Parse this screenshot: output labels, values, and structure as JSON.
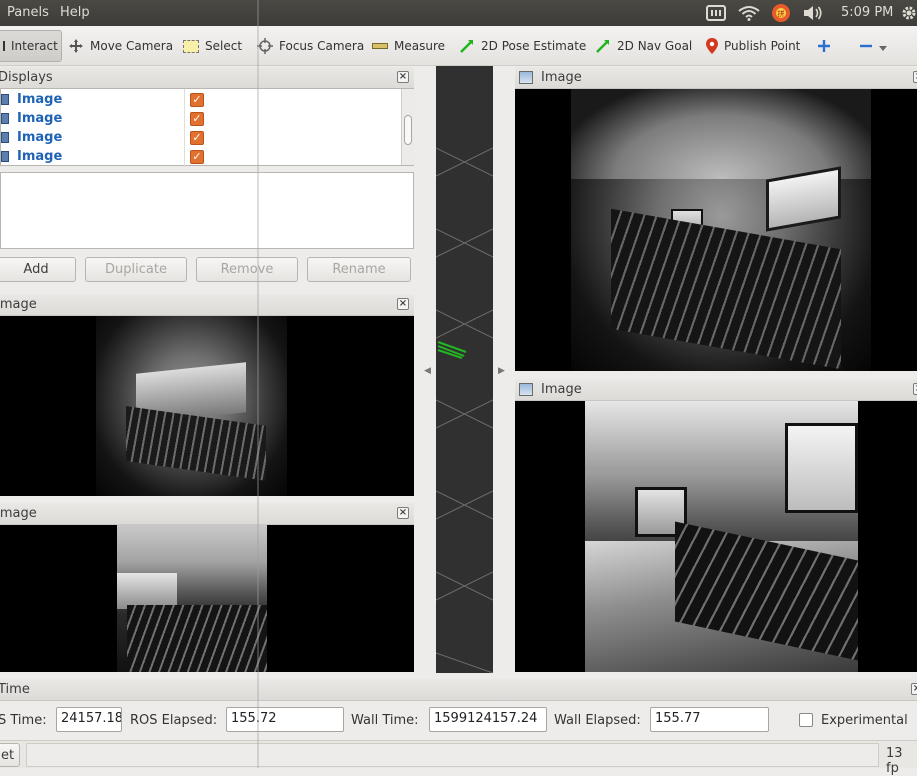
{
  "menubar": {
    "items": [
      "Panels",
      "Help"
    ],
    "clock": "5:09 PM"
  },
  "toolbar": {
    "interact": "Interact",
    "move_camera": "Move Camera",
    "select": "Select",
    "focus_camera": "Focus Camera",
    "measure": "Measure",
    "pose_estimate": "2D Pose Estimate",
    "nav_goal": "2D Nav Goal",
    "publish_point": "Publish Point"
  },
  "displays": {
    "title": "Displays",
    "items": [
      {
        "label": "Image",
        "checked": true
      },
      {
        "label": "Image",
        "checked": true
      },
      {
        "label": "Image",
        "checked": true
      },
      {
        "label": "Image",
        "checked": true
      }
    ],
    "buttons": {
      "add": "Add",
      "duplicate": "Duplicate",
      "remove": "Remove",
      "rename": "Rename"
    }
  },
  "image_panels": {
    "left_top": "Image",
    "left_bottom": "Image",
    "right_top": "Image",
    "right_bottom": "Image"
  },
  "time_panel": {
    "title": "Time",
    "ros_time_label": "S Time:",
    "ros_time": "24157.18",
    "ros_elapsed_label": "ROS Elapsed:",
    "ros_elapsed": "155.72",
    "wall_time_label": "Wall Time:",
    "wall_time": "1599124157.24",
    "wall_elapsed_label": "Wall Elapsed:",
    "wall_elapsed": "155.77",
    "experimental_label": "Experimental",
    "experimental_checked": false
  },
  "statusbar": {
    "reset": "et",
    "fps": "13 fp"
  },
  "colors": {
    "accent_orange": "#e2712f",
    "link_blue": "#1f63b5",
    "grid_green": "#22b622"
  }
}
